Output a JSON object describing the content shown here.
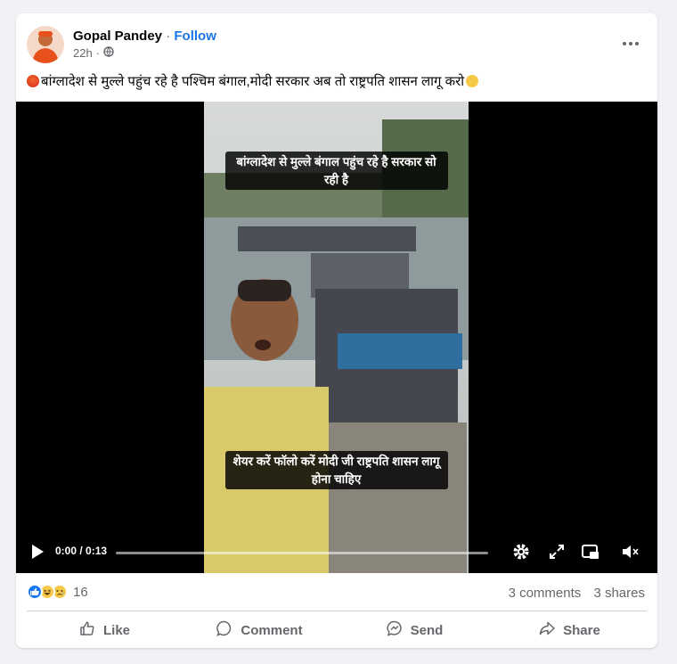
{
  "post": {
    "author": "Gopal Pandey",
    "separator": "·",
    "follow_label": "Follow",
    "time": "22h",
    "caption": "बांग्लादेश से मुल्ले पहुंच रहे है पश्चिम बंगाल,मोदी सरकार अब तो राष्ट्रपति शासन लागू करो"
  },
  "video": {
    "subtitle_top": "बांग्लादेश से मुल्ले बंगाल पहुंच रहे है सरकार सो रही है",
    "subtitle_bottom": "शेयर करें फॉलो करें मोदी जी राष्ट्रपति शासन लागू होना चाहिए",
    "time_display": "0:00 / 0:13",
    "progress_fraction": 0
  },
  "stats": {
    "reaction_count": "16",
    "comments": "3 comments",
    "shares": "3 shares",
    "reaction_icons": [
      "like-icon",
      "haha-icon",
      "sad-icon"
    ]
  },
  "actions": {
    "like": "Like",
    "comment": "Comment",
    "send": "Send",
    "share": "Share"
  },
  "colors": {
    "accent": "#1b74e4",
    "like_blue": "#1877f2",
    "muted_text": "#65676b",
    "background": "#f0f2f5"
  }
}
